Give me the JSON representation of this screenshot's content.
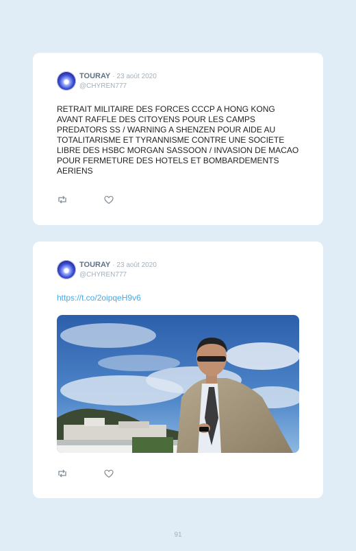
{
  "tweets": [
    {
      "name": "TOURAY",
      "date": "· 23 août 2020",
      "handle": "@CHYREN777",
      "text": "RETRAIT MILITAIRE DES FORCES CCCP A HONG KONG AVANT RAFFLE DES CITOYENS POUR LES CAMPS PREDATORS SS / WARNING A SHENZEN POUR AIDE AU TOTALITARISME ET TYRANNISME CONTRE UNE SOCIETE LIBRE DES HSBC MORGAN SASSOON / INVASION DE MACAO POUR FERMETURE DES HOTELS ET BOMBARDEMENTS AERIENS"
    },
    {
      "name": "TOURAY",
      "date": "· 23 août 2020",
      "handle": "@CHYREN777",
      "link": "https://t.co/2oipqeH9v6"
    }
  ],
  "icons": {
    "retweet": "retweet-icon",
    "like": "heart-icon"
  },
  "colors": {
    "background": "#e1edf6",
    "card": "#ffffff",
    "link": "#48a9e6",
    "name": "#5d7185",
    "muted": "#a3b0bc"
  },
  "page_number": "91"
}
